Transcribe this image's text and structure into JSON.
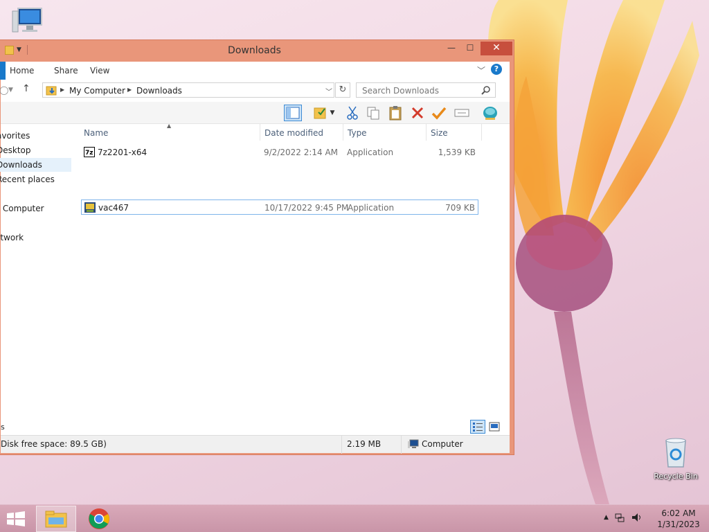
{
  "desktop": {
    "icons": {
      "computer": {
        "label": ""
      },
      "recycle_bin": {
        "label": "Recycle Bin"
      }
    }
  },
  "window": {
    "title": "Downloads",
    "controls": {
      "minimize": "—",
      "maximize": "☐",
      "close": "✕"
    },
    "ribbon_tabs": [
      "Home",
      "Share",
      "View"
    ],
    "help": "?",
    "address": {
      "crumbs": [
        "My Computer",
        "Downloads"
      ]
    },
    "search": {
      "placeholder": "Search Downloads"
    },
    "navpane": {
      "favorites": "avorites",
      "desktop": "Desktop",
      "downloads": "Downloads",
      "recent": "Recent places",
      "computer": "y Computer",
      "network": "etwork"
    },
    "columns": {
      "name": "Name",
      "date": "Date modified",
      "type": "Type",
      "size": "Size"
    },
    "files": [
      {
        "name": "7z2201-x64",
        "date": "9/2/2022 2:14 AM",
        "type": "Application",
        "size": "1,539 KB",
        "icon": "7zip-app-icon",
        "selected": false
      },
      {
        "name": "vac467",
        "date": "10/17/2022 9:45 PM",
        "type": "Application",
        "size": "709 KB",
        "icon": "setup-app-icon",
        "selected": true
      }
    ],
    "items_count": "s",
    "status": {
      "free_space": "Disk free space: 89.5 GB)",
      "size": "2.19 MB",
      "location": "Computer"
    }
  },
  "taskbar": {
    "time": "6:02 AM",
    "date": "1/31/2023"
  },
  "colors": {
    "window_border": "#e9967a",
    "close_button": "#c74f3d",
    "accent": "#1979ca",
    "selection": "#cde4f7"
  }
}
